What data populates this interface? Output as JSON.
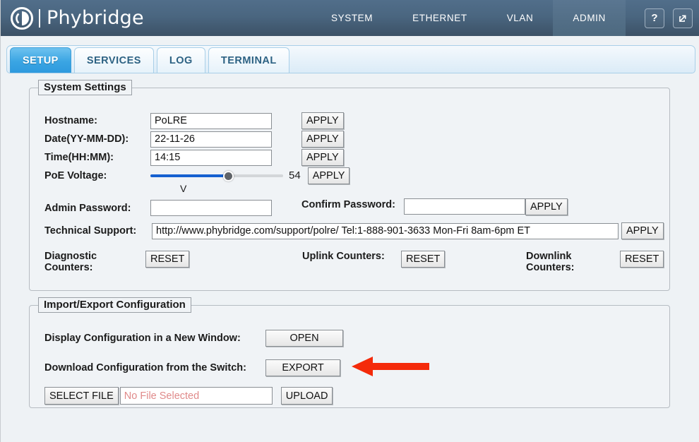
{
  "header": {
    "brand": "Phybridge",
    "logo_icon": "phybridge-logo-icon",
    "nav": [
      {
        "label": "SYSTEM",
        "active": false
      },
      {
        "label": "ETHERNET",
        "active": false
      },
      {
        "label": "VLAN",
        "active": false
      },
      {
        "label": "ADMIN",
        "active": true
      }
    ],
    "help_icon": "question-mark-icon",
    "help_label": "?",
    "external_icon": "external-link-icon"
  },
  "tabs": [
    {
      "label": "SETUP",
      "active": true
    },
    {
      "label": "SERVICES",
      "active": false
    },
    {
      "label": "LOG",
      "active": false
    },
    {
      "label": "TERMINAL",
      "active": false
    }
  ],
  "system_settings": {
    "legend": "System Settings",
    "hostname": {
      "label": "Hostname:",
      "value": "PoLRE",
      "apply": "APPLY"
    },
    "date": {
      "label": "Date(YY-MM-DD):",
      "value": "22-11-26",
      "apply": "APPLY"
    },
    "time": {
      "label": "Time(HH:MM):",
      "value": "14:15",
      "apply": "APPLY"
    },
    "poe_voltage": {
      "label": "PoE Voltage:",
      "value": "54",
      "unit": "V",
      "apply": "APPLY",
      "min": 0,
      "max": 100,
      "percent": 59
    },
    "admin_password": {
      "label": "Admin Password:",
      "value": ""
    },
    "confirm_password": {
      "label": "Confirm Password:",
      "value": "",
      "apply": "APPLY"
    },
    "technical_support": {
      "label": "Technical Support:",
      "value": "http://www.phybridge.com/support/polre/ Tel:1-888-901-3633 Mon-Fri 8am-6pm ET",
      "apply": "APPLY"
    },
    "diagnostic_counters": {
      "label": "Diagnostic Counters:",
      "reset": "RESET"
    },
    "uplink_counters": {
      "label": "Uplink Counters:",
      "reset": "RESET"
    },
    "downlink_counters": {
      "label": "Downlink Counters:",
      "reset": "RESET"
    }
  },
  "import_export": {
    "legend": "Import/Export Configuration",
    "display_config": {
      "label": "Display Configuration in a New Window:",
      "button": "OPEN"
    },
    "download_config": {
      "label": "Download Configuration from the Switch:",
      "button": "EXPORT"
    },
    "upload": {
      "select_file": "SELECT FILE",
      "file_placeholder": "No File Selected",
      "file_value": "",
      "upload_button": "UPLOAD"
    }
  },
  "annotation": {
    "arrow_icon": "left-pointing-arrow-icon",
    "color": "#f42a0a"
  },
  "colors": {
    "header_top": "#516e8a",
    "header_bottom": "#3c5166",
    "active_tab": "#3aa5e3",
    "page_bg": "#eef2f5",
    "slider_fill": "#1560d0",
    "arrow_red": "#f42a0a"
  }
}
